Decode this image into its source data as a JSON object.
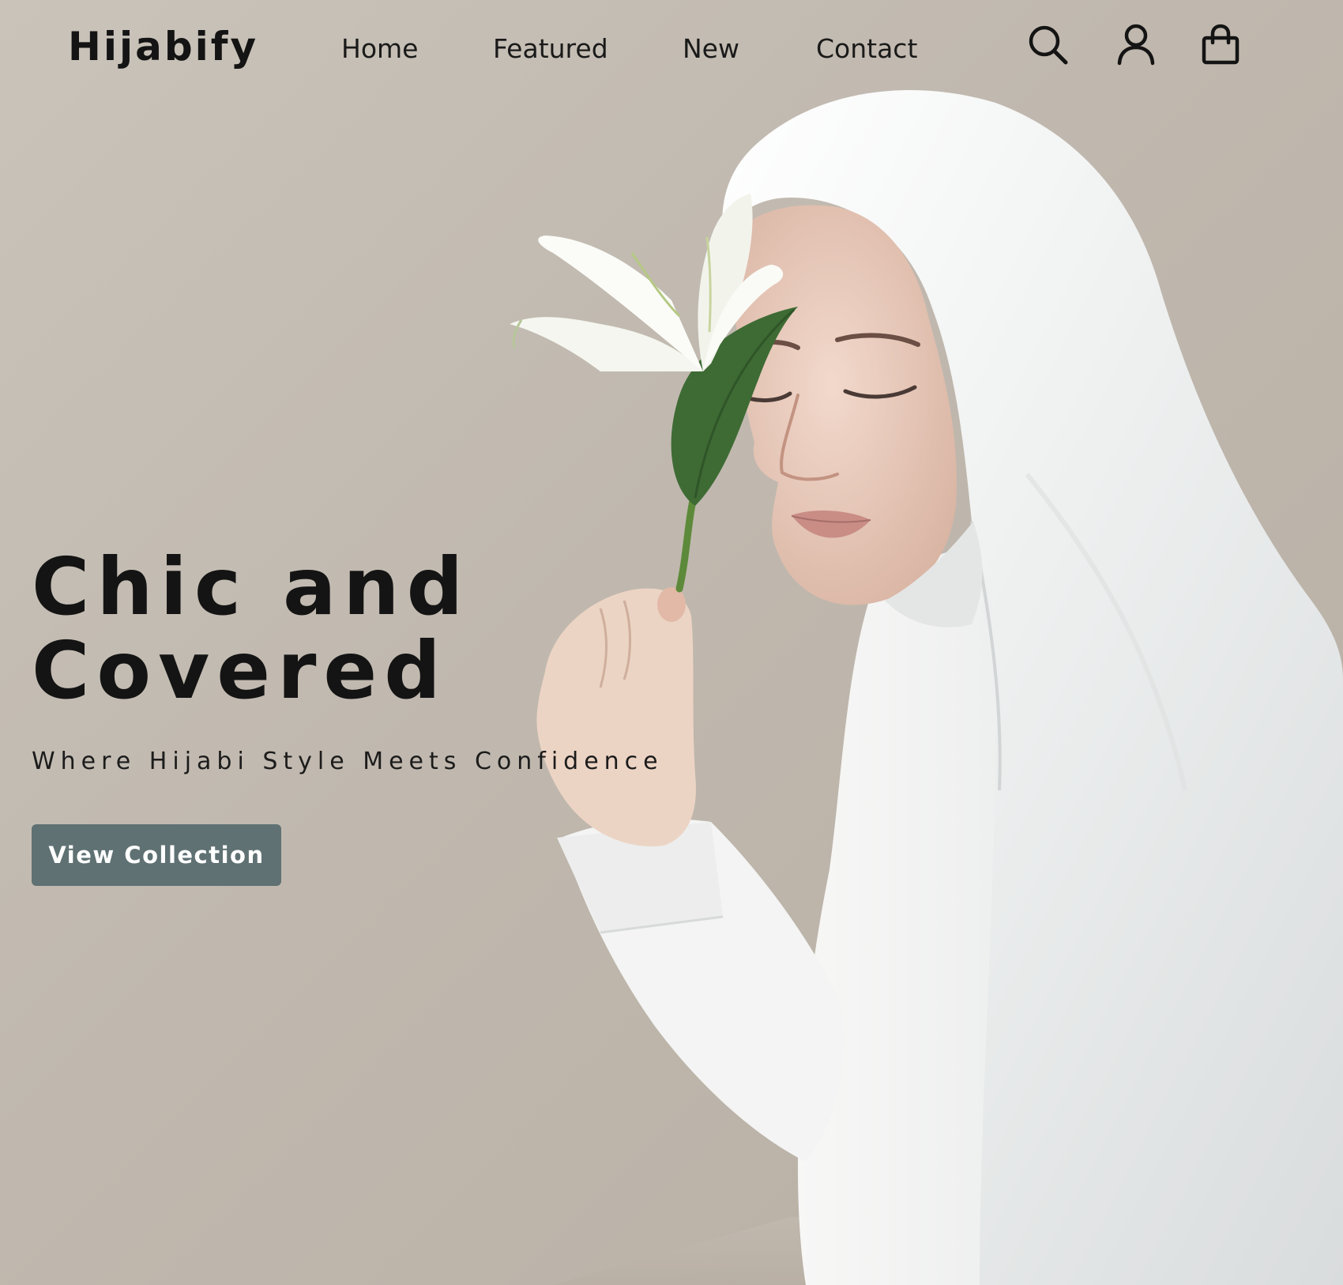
{
  "brand": {
    "name": "Hijabify"
  },
  "nav": {
    "items": [
      {
        "label": "Home"
      },
      {
        "label": "Featured"
      },
      {
        "label": "New"
      },
      {
        "label": "Contact"
      }
    ]
  },
  "header_icons": {
    "search": "search-icon",
    "account": "user-icon",
    "cart": "shopping-bag-icon"
  },
  "hero": {
    "title_line_1": "Chic and",
    "title_line_2": "Covered",
    "subtitle": "Where Hijabi Style Meets Confidence",
    "cta_label": "View Collection",
    "image": "woman-in-white-hijab-holding-lily"
  },
  "colors": {
    "background": "#c2bbb1",
    "text": "#141414",
    "button": "#5f7173",
    "button_text": "#ffffff"
  }
}
